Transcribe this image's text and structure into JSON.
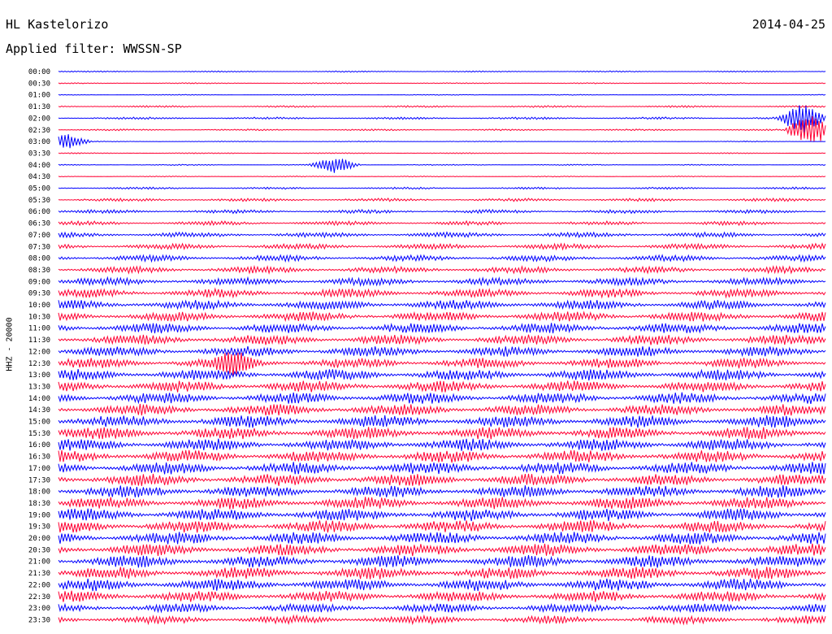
{
  "header": {
    "station": "HL Kastelorizo",
    "date": "2014-04-25",
    "filter_label": "Applied filter: WWSSN-SP"
  },
  "chart_data": {
    "type": "helicorder",
    "channel_label": "HHZ - 20000",
    "row_times": [
      "00:00",
      "00:30",
      "01:00",
      "01:30",
      "02:00",
      "02:30",
      "03:00",
      "03:30",
      "04:00",
      "04:30",
      "05:00",
      "05:30",
      "06:00",
      "06:30",
      "07:00",
      "07:30",
      "08:00",
      "08:30",
      "09:00",
      "09:30",
      "10:00",
      "10:30",
      "11:00",
      "11:30",
      "12:00",
      "12:30",
      "13:00",
      "13:30",
      "14:00",
      "14:30",
      "15:00",
      "15:30",
      "16:00",
      "16:30",
      "17:00",
      "17:30",
      "18:00",
      "18:30",
      "19:00",
      "19:30",
      "20:00",
      "20:30",
      "21:00",
      "21:30",
      "22:00",
      "22:30",
      "23:00",
      "23:30"
    ],
    "row_amplitudes": [
      0.12,
      0.1,
      0.08,
      0.18,
      0.22,
      0.15,
      0.08,
      0.1,
      0.1,
      0.08,
      0.2,
      0.3,
      0.35,
      0.4,
      0.5,
      0.55,
      0.6,
      0.65,
      0.75,
      0.85,
      0.95,
      0.95,
      1.0,
      1.0,
      1.0,
      1.0,
      1.1,
      1.1,
      1.1,
      1.1,
      1.2,
      1.2,
      1.2,
      1.2,
      1.2,
      1.2,
      1.2,
      1.2,
      1.2,
      1.2,
      1.2,
      1.2,
      1.2,
      1.2,
      1.2,
      1.1,
      0.9,
      0.8
    ],
    "events": [
      {
        "row": "02:00",
        "time_fraction": 0.97,
        "amplitude": 2.8
      },
      {
        "row": "02:30",
        "time_fraction": 0.98,
        "amplitude": 3.5
      },
      {
        "row": "03:00",
        "time_fraction": 0.01,
        "amplitude": 1.5
      },
      {
        "row": "04:00",
        "time_fraction": 0.36,
        "amplitude": 1.6
      },
      {
        "row": "12:30",
        "time_fraction": 0.23,
        "amplitude": 1.8
      }
    ],
    "colors": [
      "#0000ff",
      "#ff0033"
    ]
  }
}
